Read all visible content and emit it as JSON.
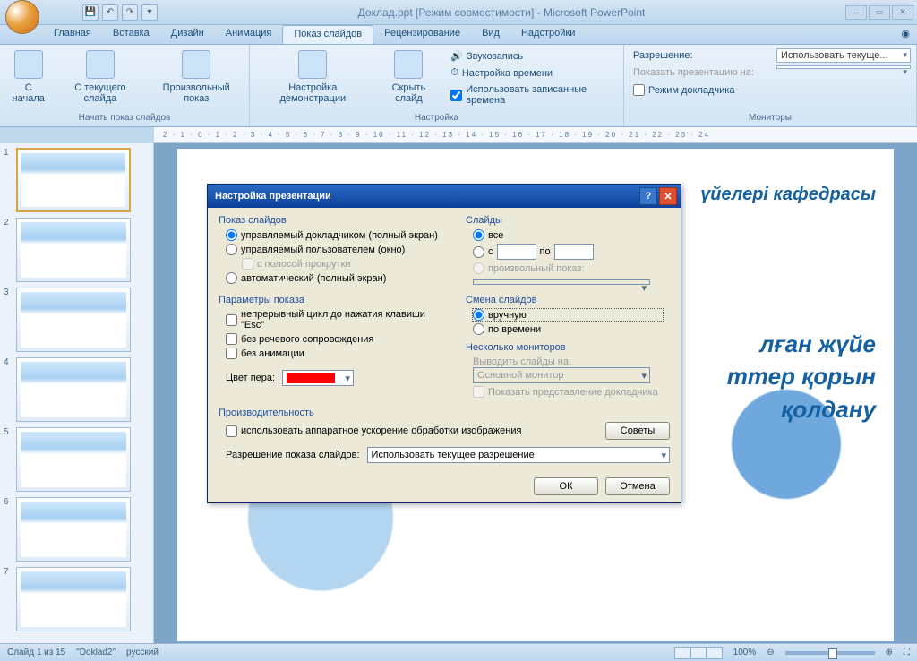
{
  "app": {
    "title": "Доклад.ppt [Режим совместимости] - Microsoft PowerPoint"
  },
  "qat": {
    "save": "💾",
    "undo": "↶",
    "redo": "↷",
    "more": "▾"
  },
  "tabs": {
    "home": "Главная",
    "insert": "Вставка",
    "design": "Дизайн",
    "animation": "Анимация",
    "slideshow": "Показ слайдов",
    "review": "Рецензирование",
    "view": "Вид",
    "addins": "Надстройки"
  },
  "ribbon": {
    "group1": {
      "from_start": "С начала",
      "from_current": "С текущего слайда",
      "custom_show": "Произвольный показ",
      "label": "Начать показ слайдов"
    },
    "group2": {
      "setup": "Настройка демонстрации",
      "hide": "Скрыть слайд",
      "record": "Звукозапись",
      "rehearse": "Настройка времени",
      "use_timings": "Использовать записанные времена",
      "label": "Настройка"
    },
    "group3": {
      "resolution": "Разрешение:",
      "resolution_value": "Использовать текуще...",
      "show_on": "Показать презентацию на:",
      "presenter": "Режим докладчика",
      "label": "Мониторы"
    }
  },
  "ruler_text": "2 · 1 · 0 · 1 · 2 · 3 · 4 · 5 · 6 · 7 · 8 · 9 · 10 · 11 · 12 · 13 · 14 · 15 · 16 · 17 · 18 · 19 · 20 · 21 · 22 · 23 · 24",
  "thumbs": [
    "1",
    "2",
    "3",
    "4",
    "5",
    "6",
    "7"
  ],
  "slide": {
    "text1": "үйелері кафедрасы",
    "text2a": "лған жүйе",
    "text2b": "ттер қорын",
    "text2c": "қолдану"
  },
  "dialog": {
    "title": "Настройка презентации",
    "show_type": {
      "label": "Показ слайдов",
      "opt1": "управляемый докладчиком (полный экран)",
      "opt2": "управляемый пользователем (окно)",
      "opt2_sub": "с полосой прокрутки",
      "opt3": "автоматический (полный экран)"
    },
    "slides": {
      "label": "Слайды",
      "all": "все",
      "from": "с",
      "to": "по",
      "custom": "произвольный показ:"
    },
    "options": {
      "label": "Параметры показа",
      "loop": "непрерывный цикл до нажатия клавиши \"Esc\"",
      "no_narration": "без речевого сопровождения",
      "no_animation": "без анимации",
      "pen_color": "Цвет пера:"
    },
    "advance": {
      "label": "Смена слайдов",
      "manual": "вручную",
      "timings": "по времени"
    },
    "monitors": {
      "label": "Несколько мониторов",
      "show_on": "Выводить слайды на:",
      "primary": "Основной монитор",
      "presenter_view": "Показать представление докладчика"
    },
    "perf": {
      "label": "Производительность",
      "hw_accel": "использовать аппаратное ускорение обработки изображения",
      "tips": "Советы",
      "resolution_lbl": "Разрешение показа слайдов:",
      "resolution_val": "Использовать текущее разрешение"
    },
    "ok": "ОК",
    "cancel": "Отмена"
  },
  "status": {
    "slide": "Слайд 1 из 15",
    "theme": "\"Doklad2\"",
    "lang": "русский",
    "zoom": "100%"
  }
}
